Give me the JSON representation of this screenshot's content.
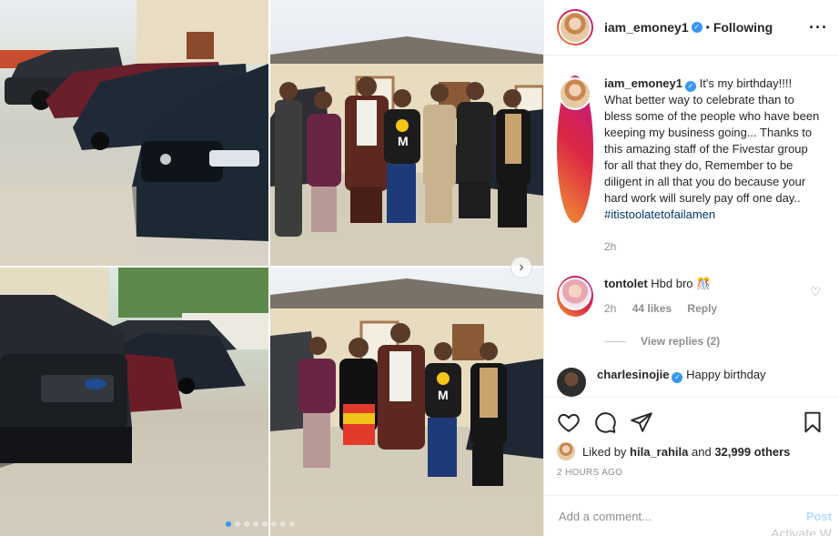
{
  "post": {
    "author": "iam_emoney1",
    "follow_status": "Following",
    "caption": "It's my birthday!!!! What better way to celebrate than to bless some of the people who have been keeping my business going... Thanks to this amazing staff of the Fivestar group for all that they do, Remember to be diligent in all that you do because your hard work will surely pay off one day..",
    "hashtag": "#itistoolatetofailamen",
    "caption_time": "2h",
    "liked_by_user": "hila_rahila",
    "liked_by_others": "32,999 others",
    "date": "2 HOURS AGO"
  },
  "comments": [
    {
      "user": "tontolet",
      "text": "Hbd bro 🎊",
      "time": "2h",
      "likes": "44 likes",
      "reply_label": "Reply",
      "view_replies": "View replies (2)"
    },
    {
      "user": "charlesinojie",
      "text": "Happy birthday"
    }
  ],
  "labels": {
    "liked_by": "Liked by",
    "and": "and",
    "add_comment_placeholder": "Add a comment...",
    "post_button": "Post",
    "watermark": "Activate W"
  },
  "icons": [
    "heart-icon",
    "comment-icon",
    "share-icon",
    "bookmark-icon",
    "verified-icon",
    "more-icon",
    "next-arrow-icon"
  ],
  "colors": {
    "verified": "#3897f0",
    "link": "#00376b",
    "muted": "#8e8e8e",
    "post_disabled": "#b2dffc"
  }
}
